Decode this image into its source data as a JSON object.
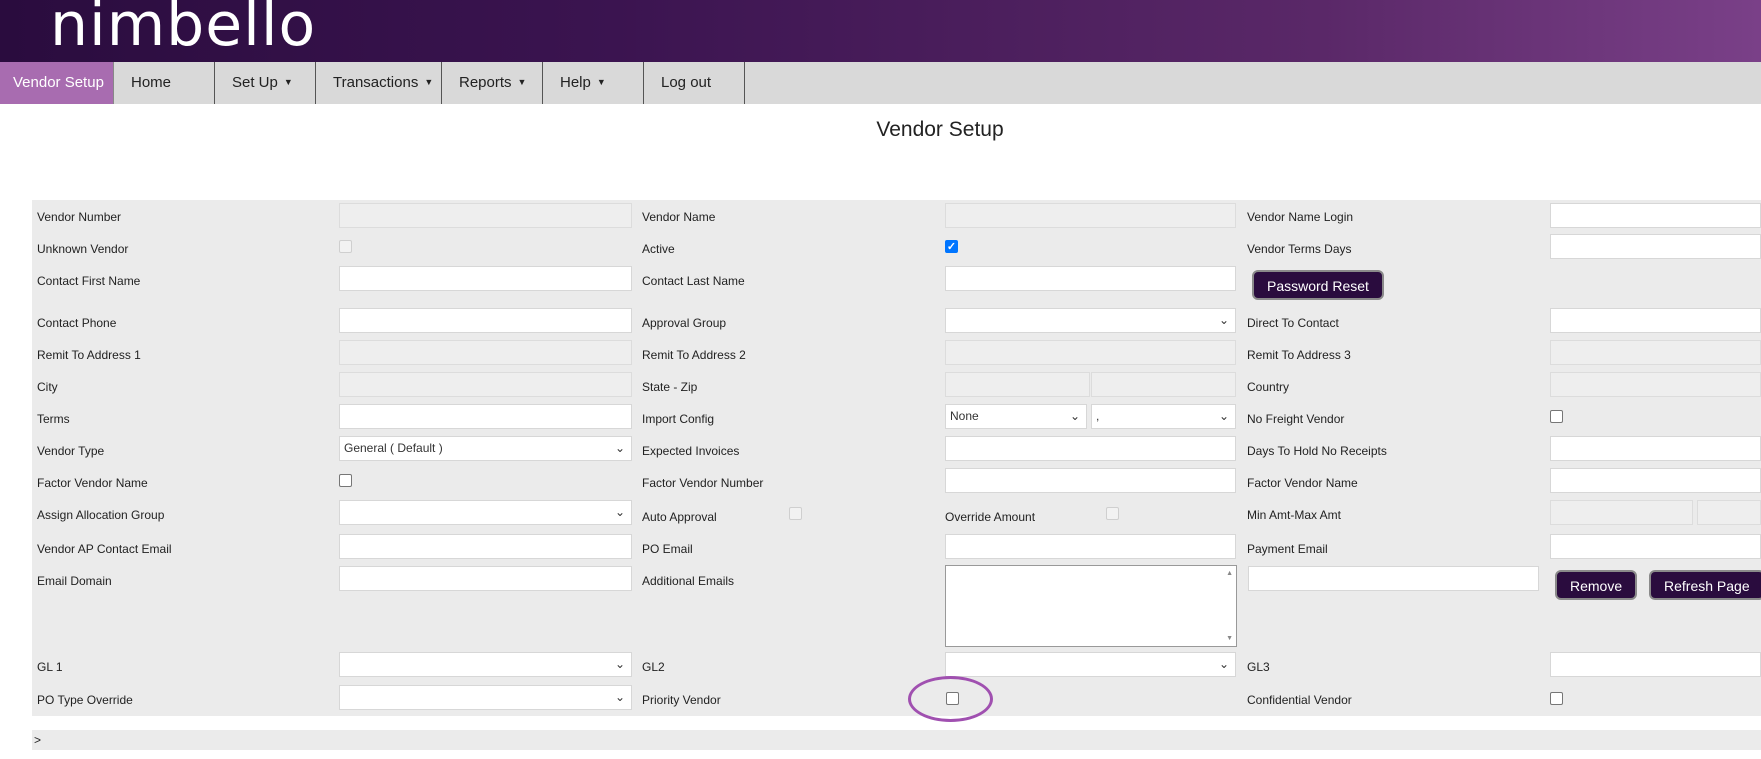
{
  "app": {
    "logo_text": "nimbello",
    "page_title": "Vendor Setup"
  },
  "nav": {
    "items": [
      {
        "label": "Vendor Setup",
        "active": true
      },
      {
        "label": "Home"
      },
      {
        "label": "Set Up",
        "dropdown": true
      },
      {
        "label": "Transactions",
        "dropdown": true
      },
      {
        "label": "Reports",
        "dropdown": true
      },
      {
        "label": "Help",
        "dropdown": true
      },
      {
        "label": "Log out"
      }
    ],
    "caret": "▼"
  },
  "form": {
    "vendor_number": "Vendor Number",
    "vendor_name": "Vendor Name",
    "vendor_name_login": "Vendor Name Login",
    "unknown_vendor": "Unknown Vendor",
    "active": "Active",
    "vendor_terms_days": "Vendor Terms Days",
    "contact_first_name": "Contact First Name",
    "contact_last_name": "Contact Last Name",
    "password_reset": "Password Reset",
    "contact_phone": "Contact Phone",
    "approval_group": "Approval Group",
    "direct_to_contact": "Direct To Contact",
    "remit_to_address_1": "Remit To Address 1",
    "remit_to_address_2": "Remit To Address 2",
    "remit_to_address_3": "Remit To Address 3",
    "city": "City",
    "state_zip": "State - Zip",
    "country": "Country",
    "terms": "Terms",
    "import_config": "Import Config",
    "import_config_value_1": "None",
    "import_config_value_2": ",",
    "no_freight_vendor": "No Freight Vendor",
    "vendor_type": "Vendor Type",
    "vendor_type_value": "General ( Default )",
    "expected_invoices": "Expected Invoices",
    "days_to_hold_no_receipts": "Days To Hold No Receipts",
    "factor_vendor_name": "Factor Vendor Name",
    "factor_vendor_number": "Factor Vendor Number",
    "factor_vendor_name_2": "Factor Vendor Name",
    "assign_allocation_group": "Assign Allocation Group",
    "auto_approval": "Auto Approval",
    "override_amount": "Override Amount",
    "min_max_amt": "Min Amt-Max Amt",
    "vendor_ap_contact_email": "Vendor AP Contact Email",
    "po_email": "PO Email",
    "payment_email": "Payment Email",
    "email_domain": "Email Domain",
    "additional_emails": "Additional Emails",
    "remove": "Remove",
    "refresh_page": "Refresh Page",
    "gl1": "GL 1",
    "gl2": "GL2",
    "gl3": "GL3",
    "po_type_override": "PO Type Override",
    "priority_vendor": "Priority Vendor",
    "confidential_vendor": "Confidential Vendor"
  },
  "footer": {
    "expander": ">"
  },
  "icons": {
    "select_arrow": "⌄",
    "checkmark": "✓",
    "scroll_up": "▲",
    "scroll_down": "▼"
  },
  "colors": {
    "brand_dark": "#2a0c3e",
    "nav_active": "#a86cb0",
    "highlight_ring": "#a050b0",
    "checkbox_checked": "#0075ff"
  }
}
